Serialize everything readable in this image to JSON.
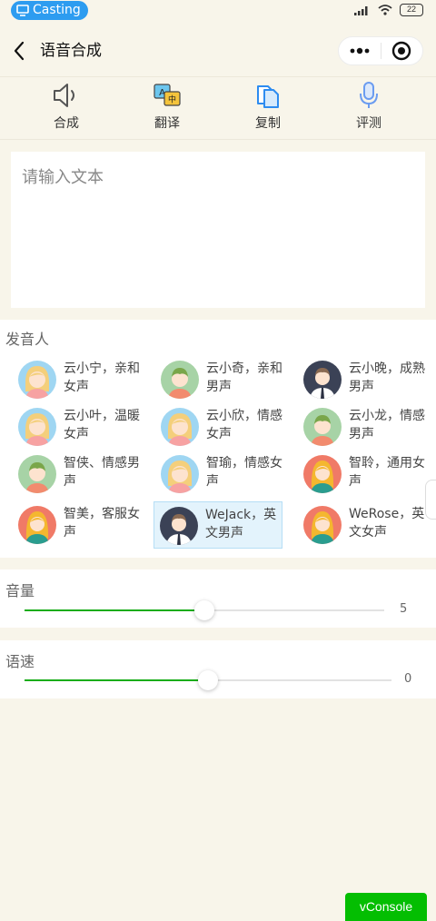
{
  "status_bar": {
    "casting_label": "Casting",
    "battery": "22"
  },
  "navbar": {
    "title": "语音合成"
  },
  "toolbar": {
    "items": [
      {
        "label": "合成",
        "icon": "speaker-icon"
      },
      {
        "label": "翻译",
        "icon": "translate-icon"
      },
      {
        "label": "复制",
        "icon": "copy-icon"
      },
      {
        "label": "评测",
        "icon": "microphone-icon"
      }
    ]
  },
  "input": {
    "placeholder": "请输入文本",
    "value": ""
  },
  "voices": {
    "title": "发音人",
    "selected_index": 10,
    "items": [
      {
        "name": "云小宁，亲和女声",
        "avatar": "female-avatar"
      },
      {
        "name": "云小奇，亲和男声",
        "avatar": "male-avatar"
      },
      {
        "name": "云小晚，成熟男声",
        "avatar": "male-suit-avatar"
      },
      {
        "name": "云小叶，温暖女声",
        "avatar": "female-avatar"
      },
      {
        "name": "云小欣，情感女声",
        "avatar": "female-avatar"
      },
      {
        "name": "云小龙，情感男声",
        "avatar": "male-avatar"
      },
      {
        "name": "智侠、情感男声",
        "avatar": "male-avatar"
      },
      {
        "name": "智瑜，情感女声",
        "avatar": "female-avatar"
      },
      {
        "name": "智聆，通用女声",
        "avatar": "blonde-female-avatar"
      },
      {
        "name": "智美，客服女声",
        "avatar": "blonde-female-avatar"
      },
      {
        "name": "WeJack，英文男声",
        "avatar": "male-suit-avatar"
      },
      {
        "name": "WeRose，英文女声",
        "avatar": "blonde-female-avatar"
      }
    ]
  },
  "volume": {
    "title": "音量",
    "value": "5",
    "fraction": 0.5
  },
  "speed": {
    "title": "语速",
    "value": "0",
    "fraction": 0.5
  },
  "vconsole": {
    "label": "vConsole"
  },
  "colors": {
    "accent": "#1aad19",
    "casting": "#2d9cf0",
    "toolbar_blue": "#2d8cf0",
    "vconsole": "#04be02"
  }
}
